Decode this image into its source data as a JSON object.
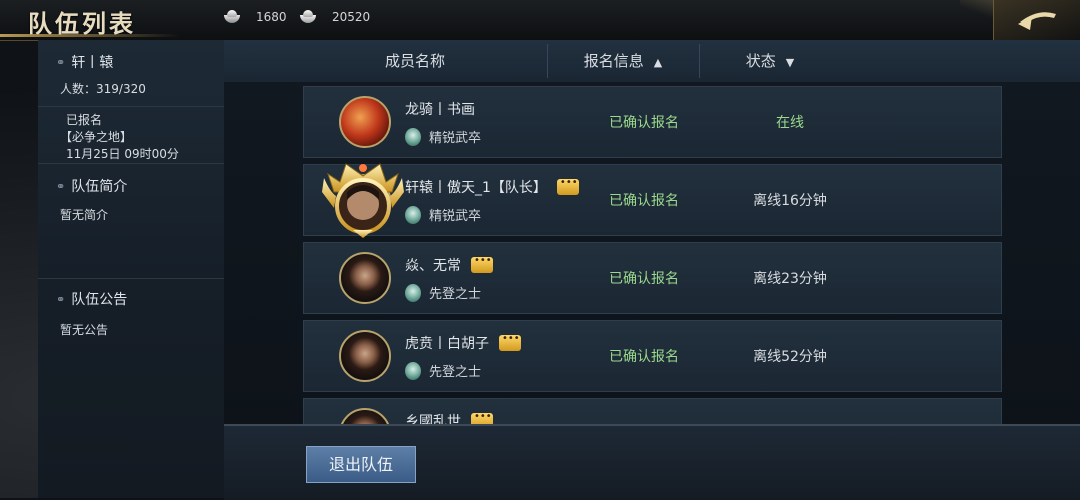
{
  "header": {
    "title": "队伍列表",
    "currencies": [
      {
        "icon": "silver-ingot-icon",
        "value": "1680"
      },
      {
        "icon": "silver-ingot-icon",
        "value": "20520"
      }
    ],
    "back_icon": "return-arrow-icon"
  },
  "team": {
    "name": "轩丨辕",
    "members_label": "人数：319/320",
    "signup": {
      "status": "已报名",
      "event": "【必争之地】",
      "time": "11月25日 09时00分"
    },
    "intro_title": "队伍简介",
    "intro_text": "暂无简介",
    "notice_title": "队伍公告",
    "notice_text": "暂无公告"
  },
  "columns": {
    "name": "成员名称",
    "signup": "报名信息",
    "status": "状态"
  },
  "members": [
    {
      "name": "龙骑丨书画",
      "rank": "精锐武卒",
      "signup": "已确认报名",
      "status": "在线",
      "chat": false
    },
    {
      "name": "轩辕丨傲天_1【队长】",
      "rank": "精锐武卒",
      "signup": "已确认报名",
      "status": "离线16分钟",
      "chat": true
    },
    {
      "name": "焱、无常",
      "rank": "先登之士",
      "signup": "已确认报名",
      "status": "离线23分钟",
      "chat": true
    },
    {
      "name": "虎贲丨白胡子",
      "rank": "先登之士",
      "signup": "已确认报名",
      "status": "离线52分钟",
      "chat": true
    },
    {
      "name": "乡國乱世",
      "rank": "",
      "signup": "",
      "status": "",
      "chat": true
    }
  ],
  "actions": {
    "quit": "退出队伍"
  },
  "colors": {
    "accent_gold": "#b8a36a",
    "confirm_green": "#9ad88d",
    "button_blue": "#4a6d97"
  }
}
